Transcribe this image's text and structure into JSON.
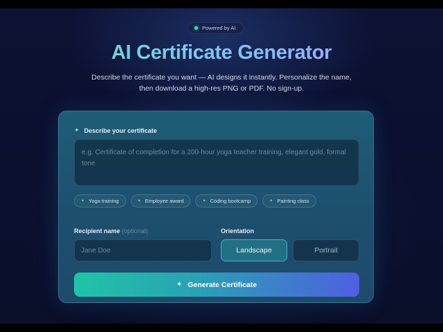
{
  "badge": {
    "text": "Powered by AI",
    "dot_color": "#2ee6b4"
  },
  "header": {
    "title": "AI Certificate Generator",
    "subtitle": "Describe the certificate you want — AI designs it instantly. Personalize the name, then download a high-res PNG or PDF. No sign-up."
  },
  "form": {
    "describe_label": "Describe your certificate",
    "describe_placeholder": "e.g. Certificate of completion for a 200-hour yoga teacher training, elegant gold, formal tone",
    "chips": [
      {
        "label": "Yoga training"
      },
      {
        "label": "Employee award"
      },
      {
        "label": "Coding bootcamp"
      },
      {
        "label": "Painting class"
      }
    ],
    "recipient_label": "Recipient name",
    "recipient_optional": "(optional)",
    "recipient_placeholder": "Jane Doe",
    "orientation_label": "Orientation",
    "orientation_options": [
      "Landscape",
      "Portrait"
    ],
    "orientation_selected": "Landscape",
    "generate_label": "Generate Certificate"
  },
  "icons": {
    "badge_dot": "status-dot-icon",
    "describe": "sparkle-icon",
    "chip": "dot-icon",
    "generate": "sparkle-icon"
  },
  "colors": {
    "accent_teal": "#20c4a6",
    "accent_indigo": "#4f5fe0",
    "card_bg": "#1e5d76"
  }
}
